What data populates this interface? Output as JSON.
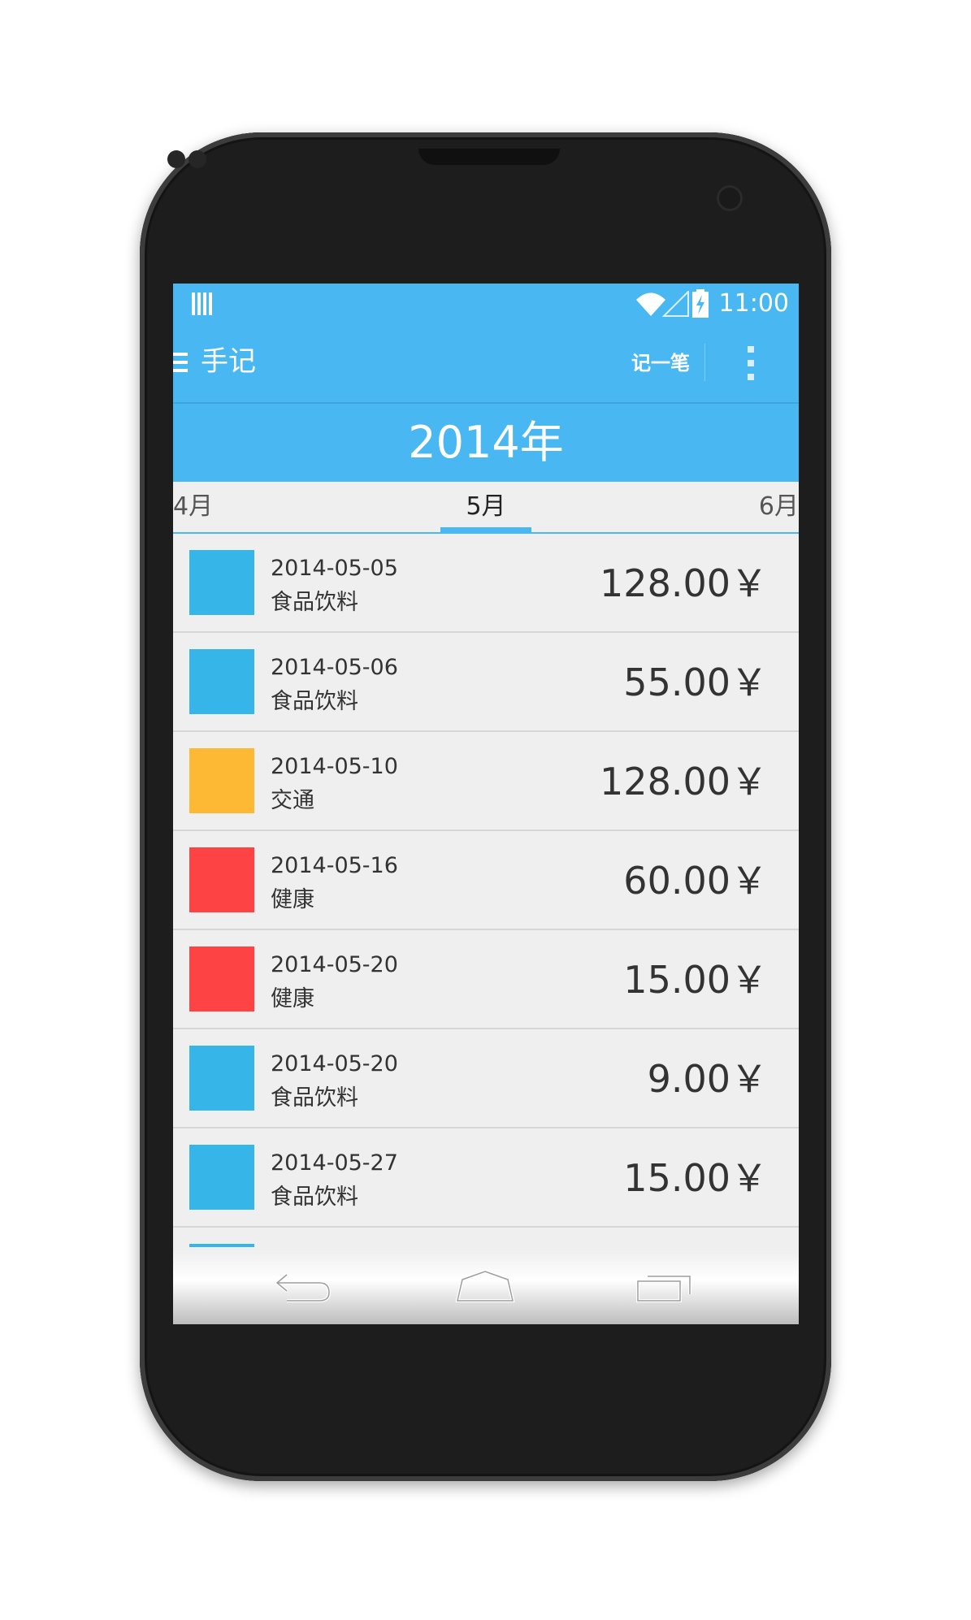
{
  "status_bar": {
    "time": "11:00"
  },
  "action_bar": {
    "title": "手记",
    "add_label": "记一笔"
  },
  "year_label": "2014年",
  "months": {
    "prev": "4月",
    "current": "5月",
    "next": "6月"
  },
  "records": [
    {
      "date": "2014-05-05",
      "category": "食品饮料",
      "amount": "128.00￥",
      "color": "#36b6e8"
    },
    {
      "date": "2014-05-06",
      "category": "食品饮料",
      "amount": "55.00￥",
      "color": "#36b6e8"
    },
    {
      "date": "2014-05-10",
      "category": "交通",
      "amount": "128.00￥",
      "color": "#fdb933"
    },
    {
      "date": "2014-05-16",
      "category": "健康",
      "amount": "60.00￥",
      "color": "#fd4343"
    },
    {
      "date": "2014-05-20",
      "category": "健康",
      "amount": "15.00￥",
      "color": "#fd4343"
    },
    {
      "date": "2014-05-20",
      "category": "食品饮料",
      "amount": "9.00￥",
      "color": "#36b6e8"
    },
    {
      "date": "2014-05-27",
      "category": "食品饮料",
      "amount": "15.00￥",
      "color": "#36b6e8"
    }
  ],
  "icons": {
    "drawer": "menu-icon",
    "overflow": "overflow-menu-icon",
    "back": "back-icon",
    "home": "home-icon",
    "recents": "recent-apps-icon"
  },
  "colors": {
    "accent": "#49b8f2",
    "background": "#efefef"
  }
}
